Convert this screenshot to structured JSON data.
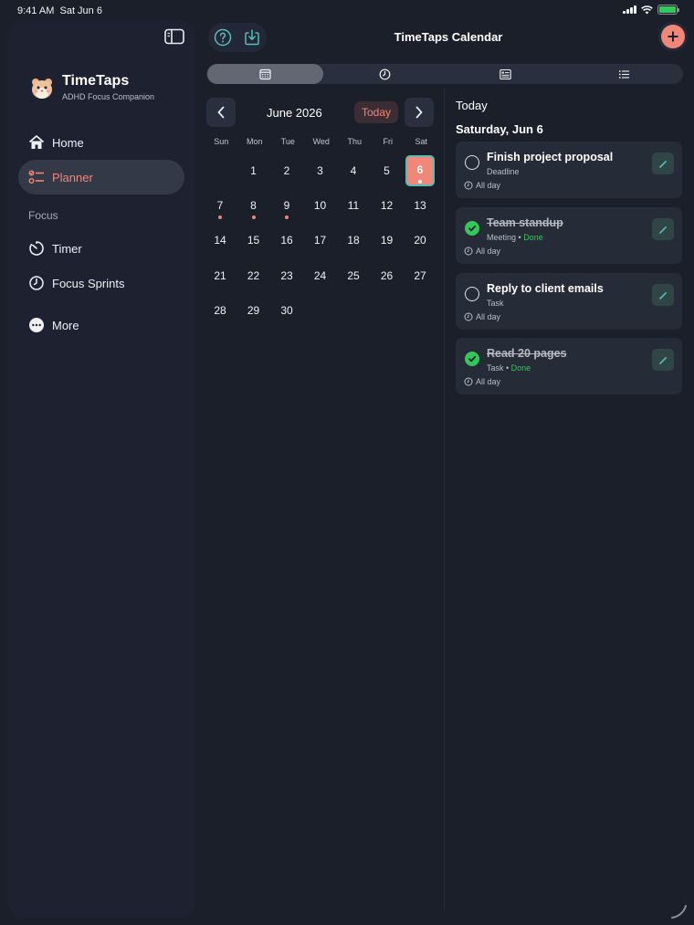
{
  "status_bar": {
    "time": "9:41 AM",
    "date": "Sat Jun 6"
  },
  "sidebar": {
    "brand_name": "TimeTaps",
    "brand_subtitle": "ADHD Focus Companion",
    "items": [
      {
        "label": "Home",
        "icon": "house-icon"
      },
      {
        "label": "Planner",
        "icon": "checklist-icon",
        "active": true
      },
      {
        "label": "Timer",
        "icon": "timer-icon"
      },
      {
        "label": "Focus Sprints",
        "icon": "clock-icon"
      },
      {
        "label": "More",
        "icon": "ellipsis-circle-icon"
      }
    ],
    "section_focus": "Focus"
  },
  "header": {
    "title": "TimeTaps Calendar"
  },
  "view_tabs": [
    "calendar-icon",
    "clock-icon",
    "list-detail-icon",
    "list-icon"
  ],
  "calendar": {
    "month_label": "June 2026",
    "today_label": "Today",
    "weekdays": [
      "Sun",
      "Mon",
      "Tue",
      "Wed",
      "Thu",
      "Fri",
      "Sat"
    ],
    "days": [
      "1",
      "2",
      "3",
      "4",
      "5",
      "6",
      "7",
      "8",
      "9",
      "10",
      "11",
      "12",
      "13",
      "14",
      "15",
      "16",
      "17",
      "18",
      "19",
      "20",
      "21",
      "22",
      "23",
      "24",
      "25",
      "26",
      "27",
      "28",
      "29",
      "30"
    ],
    "selected_day": "6",
    "days_with_events": [
      "6",
      "7",
      "8",
      "9"
    ]
  },
  "agenda": {
    "heading": "Today",
    "date_label": "Saturday, Jun 6",
    "items": [
      {
        "title": "Finish project proposal",
        "type": "Deadline",
        "done": false,
        "done_label": "",
        "time": "All day"
      },
      {
        "title": "Team standup",
        "type": "Meeting",
        "done": true,
        "done_label": "Done",
        "time": "All day"
      },
      {
        "title": "Reply to client emails",
        "type": "Task",
        "done": false,
        "done_label": "",
        "time": "All day"
      },
      {
        "title": "Read 20 pages",
        "type": "Task",
        "done": true,
        "done_label": "Done",
        "time": "All day"
      }
    ]
  },
  "colors": {
    "accent": "#f08779",
    "teal": "#5bbcb6",
    "success": "#34c759",
    "background": "#1b1f2a"
  }
}
